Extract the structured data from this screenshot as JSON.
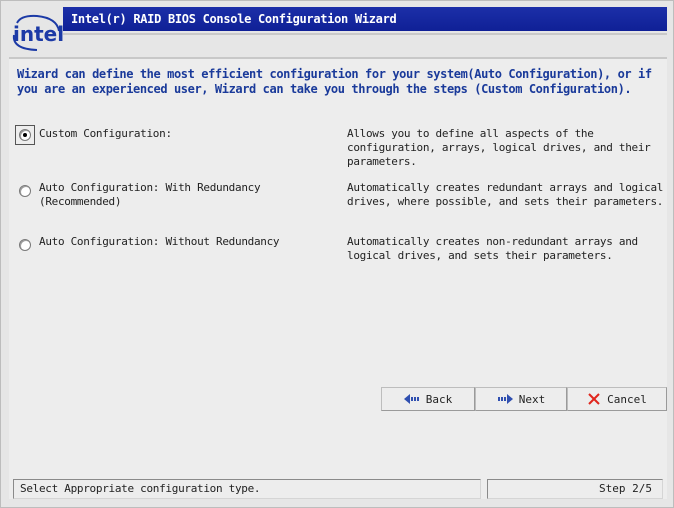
{
  "window": {
    "title": "Intel(r) RAID BIOS Console Configuration Wizard",
    "logo_text": "intel"
  },
  "intro": {
    "text": "Wizard can define the most efficient configuration for your system(Auto Configuration), or if you are an experienced user, Wizard can take you through the steps (Custom Configuration)."
  },
  "options": [
    {
      "label": "Custom Configuration:",
      "description": "Allows you to define all aspects of the configuration, arrays, logical drives, and their parameters.",
      "selected": true
    },
    {
      "label": "Auto Configuration:  With Redundancy (Recommended)",
      "description": "Automatically creates redundant arrays and logical drives, where possible, and sets their parameters.",
      "selected": false
    },
    {
      "label": "Auto Configuration:  Without Redundancy",
      "description": "Automatically creates non-redundant arrays and logical drives, and sets their parameters.",
      "selected": false
    }
  ],
  "buttons": {
    "back_label": "Back",
    "next_label": "Next",
    "cancel_label": "Cancel"
  },
  "status": {
    "message": "Select Appropriate configuration type.",
    "step": "Step 2/5"
  },
  "colors": {
    "title_bar": "#1c2fa8",
    "intro_text": "#1a3a9a",
    "cancel_icon": "#e0261d",
    "arrow_icon": "#2f4fb0"
  }
}
